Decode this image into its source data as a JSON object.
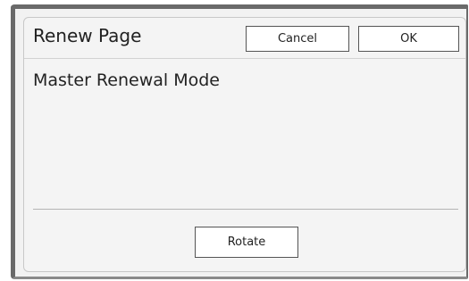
{
  "dialog": {
    "title": "Renew Page",
    "cancel_label": "Cancel",
    "ok_label": "OK"
  },
  "content": {
    "mode_label": "Master Renewal Mode",
    "rotate_label": "Rotate"
  }
}
